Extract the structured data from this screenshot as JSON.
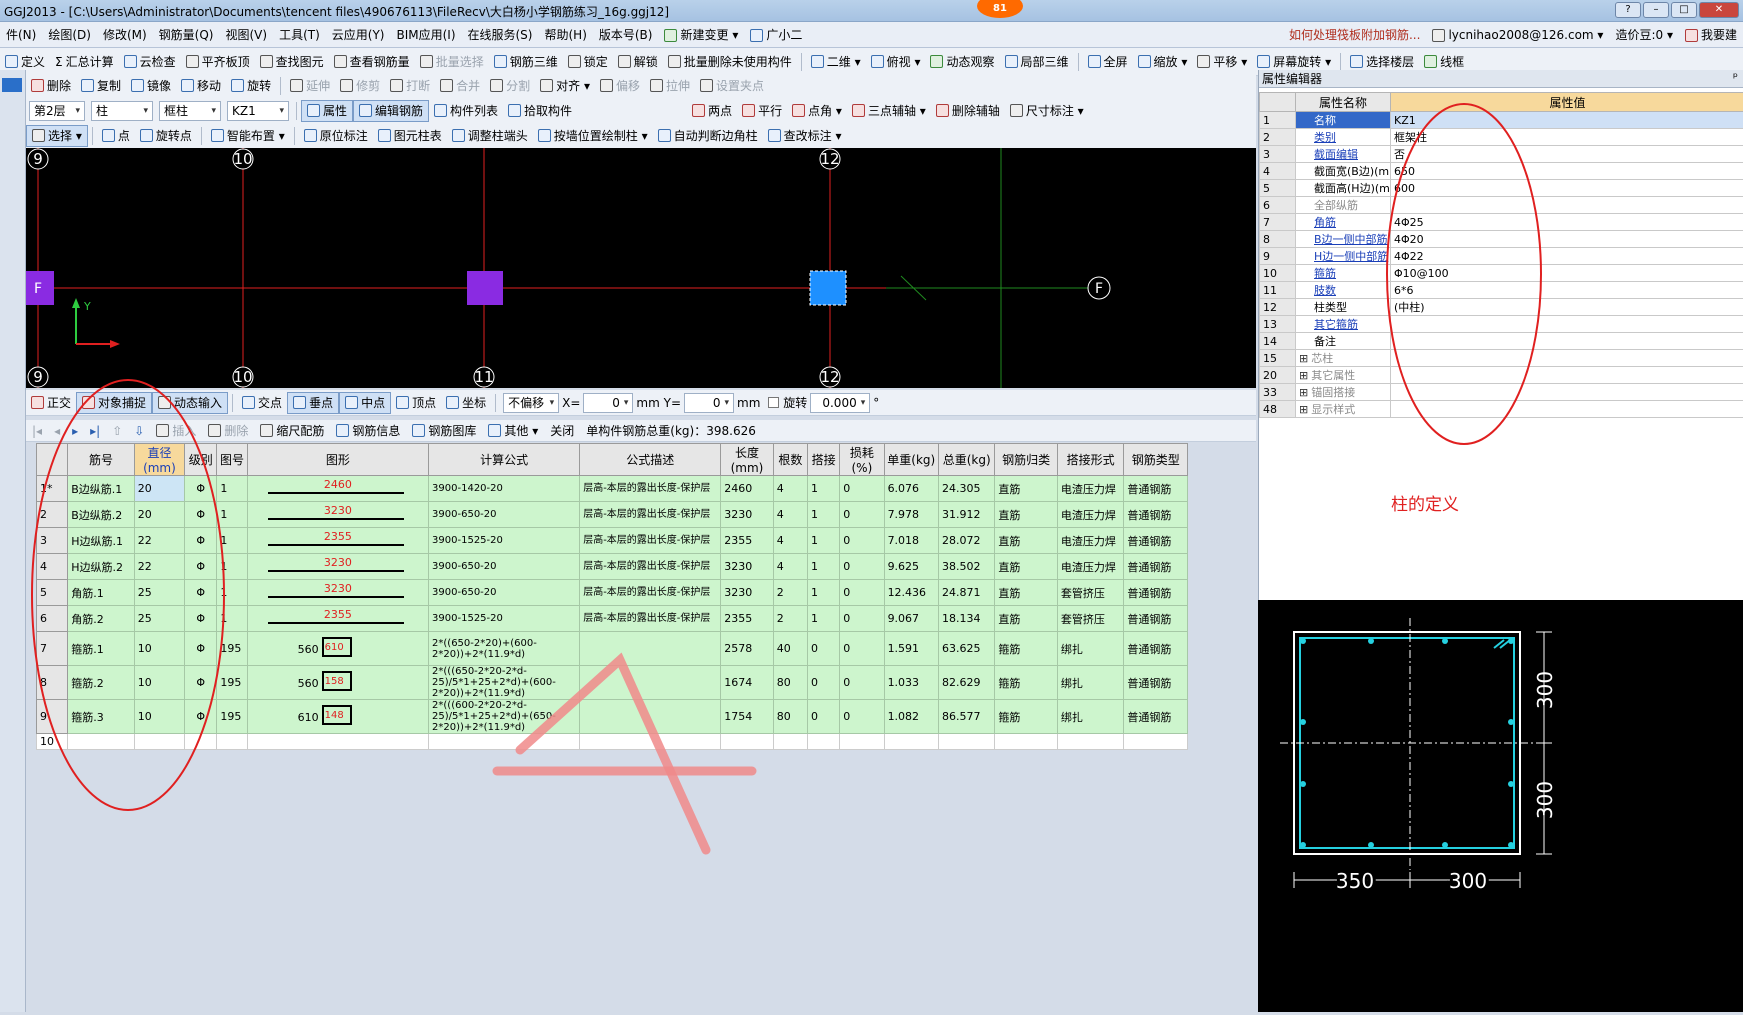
{
  "title": "GGJ2013 - [C:\\Users\\Administrator\\Documents\\tencent files\\490676113\\FileRecv\\大白杨小学钢筋练习_16g.ggj12]",
  "notification_count": "81",
  "menu": [
    "件(N)",
    "绘图(D)",
    "修改(M)",
    "钢筋量(Q)",
    "视图(V)",
    "工具(T)",
    "云应用(Y)",
    "BIM应用(I)",
    "在线服务(S)",
    "帮助(H)",
    "版本号(B)",
    "新建变更",
    "广小二"
  ],
  "menu_right": {
    "question": "如何处理筏板附加钢筋...",
    "account": "lycnihao2008@126.com",
    "coins": "造价豆:0",
    "suggest": "我要建"
  },
  "toolbar1": [
    "定义",
    "汇总计算",
    "云检查",
    "平齐板顶",
    "查找图元",
    "查看钢筋量",
    "批量选择",
    "钢筋三维",
    "锁定",
    "解锁",
    "批量删除未使用构件",
    "二维",
    "俯视",
    "动态观察",
    "局部三维",
    "全屏",
    "缩放",
    "平移",
    "屏幕旋转",
    "选择楼层",
    "线框"
  ],
  "toolbar2": [
    "删除",
    "复制",
    "镜像",
    "移动",
    "旋转",
    "延伸",
    "修剪",
    "打断",
    "合并",
    "分割",
    "对齐",
    "偏移",
    "拉伸",
    "设置夹点"
  ],
  "toolbar3": {
    "floor": "第2层",
    "type": "柱",
    "sub": "框柱",
    "comp": "KZ1",
    "buttons": [
      "属性",
      "编辑钢筋",
      "构件列表",
      "拾取构件"
    ],
    "aux": [
      "两点",
      "平行",
      "点角",
      "三点辅轴",
      "删除辅轴",
      "尺寸标注"
    ]
  },
  "toolbar4": [
    "选择",
    "点",
    "旋转点",
    "智能布置",
    "原位标注",
    "图元柱表",
    "调整柱端头",
    "按墙位置绘制柱",
    "自动判断边角柱",
    "查改标注"
  ],
  "canvas": {
    "axis_top": [
      "9",
      "10",
      "12"
    ],
    "axis_bottom": [
      "9",
      "10",
      "11",
      "12"
    ],
    "axis_side": "F",
    "y_label": "Y"
  },
  "inputbar": {
    "buttons": [
      "正交",
      "对象捕捉",
      "动态输入",
      "交点",
      "垂点",
      "中点",
      "顶点",
      "坐标"
    ],
    "offset": "不偏移",
    "x_label": "X=",
    "x_val": "0",
    "y_label": "Y=",
    "y_val": "0",
    "unit": "mm",
    "rotate": "旋转",
    "rotate_val": "0.000",
    "deg": "°"
  },
  "gridbar": {
    "items": [
      "插入",
      "删除",
      "缩尺配筋",
      "钢筋信息",
      "钢筋图库",
      "其他",
      "关闭"
    ],
    "total": "单构件钢筋总重(kg)：398.626"
  },
  "table": {
    "headers": [
      "",
      "筋号",
      "直径(mm)",
      "级别",
      "图号",
      "图形",
      "计算公式",
      "公式描述",
      "长度(mm)",
      "根数",
      "搭接",
      "损耗(%)",
      "单重(kg)",
      "总重(kg)",
      "钢筋归类",
      "搭接形式",
      "钢筋类型"
    ],
    "rows": [
      {
        "n": "1*",
        "name": "B边纵筋.1",
        "d": "20",
        "grade": "Φ",
        "fig": "1",
        "shape": "2460",
        "formula": "3900-1420-20",
        "desc": "层高-本层的露出长度-保护层",
        "len": "2460",
        "count": "4",
        "lap": "1",
        "loss": "0",
        "uw": "6.076",
        "tw": "24.305",
        "cat": "直筋",
        "lapform": "电渣压力焊",
        "type": "普通钢筋"
      },
      {
        "n": "2",
        "name": "B边纵筋.2",
        "d": "20",
        "grade": "Φ",
        "fig": "1",
        "shape": "3230",
        "formula": "3900-650-20",
        "desc": "层高-本层的露出长度-保护层",
        "len": "3230",
        "count": "4",
        "lap": "1",
        "loss": "0",
        "uw": "7.978",
        "tw": "31.912",
        "cat": "直筋",
        "lapform": "电渣压力焊",
        "type": "普通钢筋"
      },
      {
        "n": "3",
        "name": "H边纵筋.1",
        "d": "22",
        "grade": "Φ",
        "fig": "1",
        "shape": "2355",
        "formula": "3900-1525-20",
        "desc": "层高-本层的露出长度-保护层",
        "len": "2355",
        "count": "4",
        "lap": "1",
        "loss": "0",
        "uw": "7.018",
        "tw": "28.072",
        "cat": "直筋",
        "lapform": "电渣压力焊",
        "type": "普通钢筋"
      },
      {
        "n": "4",
        "name": "H边纵筋.2",
        "d": "22",
        "grade": "Φ",
        "fig": "1",
        "shape": "3230",
        "formula": "3900-650-20",
        "desc": "层高-本层的露出长度-保护层",
        "len": "3230",
        "count": "4",
        "lap": "1",
        "loss": "0",
        "uw": "9.625",
        "tw": "38.502",
        "cat": "直筋",
        "lapform": "电渣压力焊",
        "type": "普通钢筋"
      },
      {
        "n": "5",
        "name": "角筋.1",
        "d": "25",
        "grade": "Φ",
        "fig": "1",
        "shape": "3230",
        "formula": "3900-650-20",
        "desc": "层高-本层的露出长度-保护层",
        "len": "3230",
        "count": "2",
        "lap": "1",
        "loss": "0",
        "uw": "12.436",
        "tw": "24.871",
        "cat": "直筋",
        "lapform": "套管挤压",
        "type": "普通钢筋"
      },
      {
        "n": "6",
        "name": "角筋.2",
        "d": "25",
        "grade": "Φ",
        "fig": "1",
        "shape": "2355",
        "formula": "3900-1525-20",
        "desc": "层高-本层的露出长度-保护层",
        "len": "2355",
        "count": "2",
        "lap": "1",
        "loss": "0",
        "uw": "9.067",
        "tw": "18.134",
        "cat": "直筋",
        "lapform": "套管挤压",
        "type": "普通钢筋"
      },
      {
        "n": "7",
        "name": "箍筋.1",
        "d": "10",
        "grade": "Φ",
        "fig": "195",
        "shape_a": "560",
        "shape_b": "610",
        "formula": "2*((650-2*20)+(600-2*20))+2*(11.9*d)",
        "desc": "",
        "len": "2578",
        "count": "40",
        "lap": "0",
        "loss": "0",
        "uw": "1.591",
        "tw": "63.625",
        "cat": "箍筋",
        "lapform": "绑扎",
        "type": "普通钢筋"
      },
      {
        "n": "8",
        "name": "箍筋.2",
        "d": "10",
        "grade": "Φ",
        "fig": "195",
        "shape_a": "560",
        "shape_b": "158",
        "formula": "2*(((650-2*20-2*d-25)/5*1+25+2*d)+(600-2*20))+2*(11.9*d)",
        "desc": "",
        "len": "1674",
        "count": "80",
        "lap": "0",
        "loss": "0",
        "uw": "1.033",
        "tw": "82.629",
        "cat": "箍筋",
        "lapform": "绑扎",
        "type": "普通钢筋"
      },
      {
        "n": "9",
        "name": "箍筋.3",
        "d": "10",
        "grade": "Φ",
        "fig": "195",
        "shape_a": "610",
        "shape_b": "148",
        "formula": "2*(((600-2*20-2*d-25)/5*1+25+2*d)+(650-2*20))+2*(11.9*d)",
        "desc": "",
        "len": "1754",
        "count": "80",
        "lap": "0",
        "loss": "0",
        "uw": "1.082",
        "tw": "86.577",
        "cat": "箍筋",
        "lapform": "绑扎",
        "type": "普通钢筋"
      }
    ],
    "empty_row": "10"
  },
  "props": {
    "title": "属性编辑器",
    "pin": "ᵖ",
    "headers": [
      "",
      "属性名称",
      "属性值"
    ],
    "rows": [
      {
        "n": "1",
        "name": "名称",
        "val": "KZ1",
        "style": "blue",
        "sel": true
      },
      {
        "n": "2",
        "name": "类别",
        "val": "框架柱",
        "style": "blue"
      },
      {
        "n": "3",
        "name": "截面编辑",
        "val": "否",
        "style": "blue"
      },
      {
        "n": "4",
        "name": "截面宽(B边)(mm)",
        "val": "650",
        "style": "black"
      },
      {
        "n": "5",
        "name": "截面高(H边)(mm)",
        "val": "600",
        "style": "black"
      },
      {
        "n": "6",
        "name": "全部纵筋",
        "val": "",
        "style": "grey"
      },
      {
        "n": "7",
        "name": "角筋",
        "val": "4Φ25",
        "style": "blue"
      },
      {
        "n": "8",
        "name": "B边一侧中部筋",
        "val": "4Φ20",
        "style": "blue"
      },
      {
        "n": "9",
        "name": "H边一侧中部筋",
        "val": "4Φ22",
        "style": "blue"
      },
      {
        "n": "10",
        "name": "箍筋",
        "val": "Φ10@100",
        "style": "blue"
      },
      {
        "n": "11",
        "name": "肢数",
        "val": "6*6",
        "style": "blue"
      },
      {
        "n": "12",
        "name": "柱类型",
        "val": "(中柱)",
        "style": "black"
      },
      {
        "n": "13",
        "name": "其它箍筋",
        "val": "",
        "style": "blue"
      },
      {
        "n": "14",
        "name": "备注",
        "val": "",
        "style": "black"
      },
      {
        "n": "15",
        "name": "芯柱",
        "val": "",
        "style": "grey",
        "exp": true
      },
      {
        "n": "20",
        "name": "其它属性",
        "val": "",
        "style": "grey",
        "exp": true
      },
      {
        "n": "33",
        "name": "锚固搭接",
        "val": "",
        "style": "grey",
        "exp": true
      },
      {
        "n": "48",
        "name": "显示样式",
        "val": "",
        "style": "grey",
        "exp": true
      }
    ]
  },
  "annotation": "柱的定义",
  "preview": {
    "dim_v1": "300",
    "dim_v2": "300",
    "dim_h1": "350",
    "dim_h2": "300"
  },
  "colors": {
    "accent": "#3368c8",
    "row_green": "#cdf5cd",
    "grid_red": "#e02020",
    "annotation_red": "#e02020"
  }
}
